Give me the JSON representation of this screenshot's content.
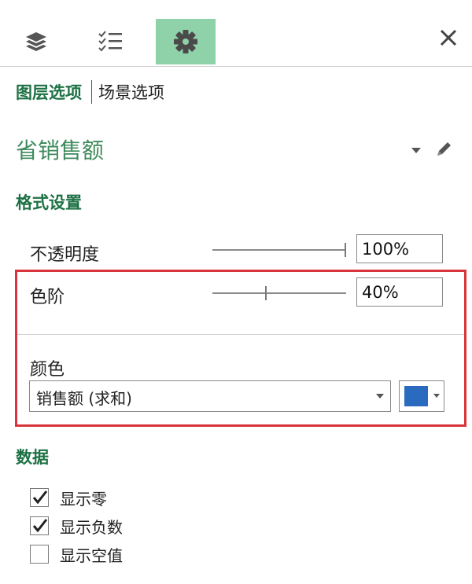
{
  "tabs": [
    {
      "icon": "layers-icon",
      "active": false
    },
    {
      "icon": "field-list-icon",
      "active": false
    },
    {
      "icon": "gear-icon",
      "active": true
    }
  ],
  "close_icon": "close-icon",
  "subtabs": {
    "layer_options": "图层选项",
    "scene_options": "场景选项"
  },
  "layer": {
    "name": "省销售额"
  },
  "format": {
    "title": "格式设置",
    "opacity": {
      "label": "不透明度",
      "value": "100%",
      "level": 1.0
    },
    "color_scale": {
      "label": "色阶",
      "value": "40%",
      "level": 0.4
    },
    "color": {
      "label": "颜色",
      "field": "销售额 (求和)",
      "swatch": "#2a6bbf"
    }
  },
  "data_section": {
    "title": "数据",
    "checkboxes": [
      {
        "label": "显示零",
        "checked": true
      },
      {
        "label": "显示负数",
        "checked": true
      },
      {
        "label": "显示空值",
        "checked": false
      }
    ]
  },
  "colors": {
    "accent_green": "#1e7145",
    "active_tab": "#8fd1a8",
    "highlight_border": "#d9343b"
  }
}
